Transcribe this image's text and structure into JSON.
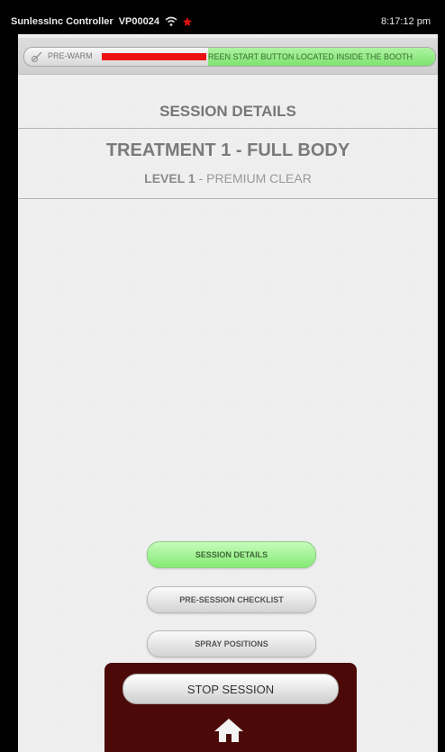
{
  "status_bar": {
    "app_name": "SunlessInc Controller",
    "device_id": "VP00024",
    "time": "8:17:12 pm"
  },
  "prewarm": {
    "label": "PRE-WARM",
    "progress": 0.26,
    "message": "REEN START BUTTON LOCATED INSIDE THE BOOTH"
  },
  "session": {
    "title": "SESSION DETAILS",
    "treatment": "TREATMENT 1 - FULL BODY",
    "level_prefix": "LEVEL 1",
    "level_separator": " - ",
    "level_name": "PREMIUM CLEAR"
  },
  "nav": {
    "session_details": "SESSION DETAILS",
    "pre_session_checklist": "PRE-SESSION CHECKLIST",
    "spray_positions": "SPRAY POSITIONS"
  },
  "controls": {
    "stop_session": "STOP SESSION",
    "home_icon": "home-icon"
  },
  "colors": {
    "prewarm_bar": "#ee1111",
    "active_green": "#84ea74",
    "panel": "#4b0a08"
  }
}
